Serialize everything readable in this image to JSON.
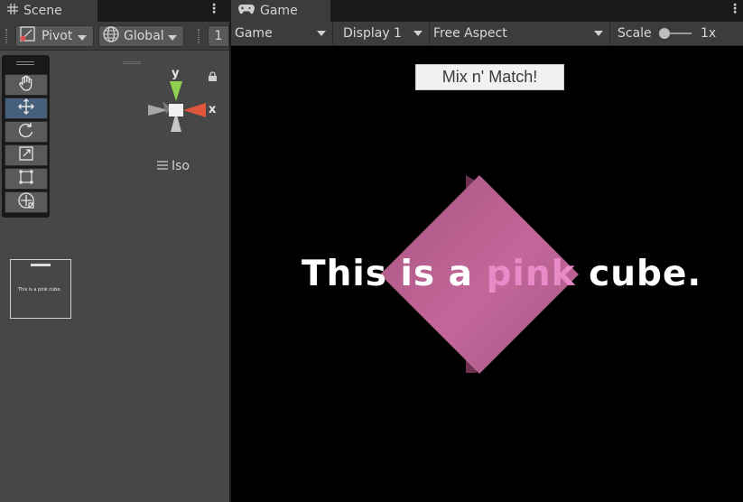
{
  "scene": {
    "tab_label": "Scene",
    "toolbar": {
      "pivot_label": "Pivot",
      "global_label": "Global",
      "snap_value": "1"
    },
    "tools": [
      {
        "name": "hand-tool",
        "icon": "hand-icon"
      },
      {
        "name": "move-tool",
        "icon": "move-arrows-icon",
        "active": true
      },
      {
        "name": "rotate-tool",
        "icon": "rotate-icon"
      },
      {
        "name": "scale-tool",
        "icon": "scale-icon"
      },
      {
        "name": "rect-tool",
        "icon": "rect-transform-icon"
      },
      {
        "name": "transform-tool",
        "icon": "transform-icon"
      }
    ],
    "gizmo": {
      "y_label": "y",
      "x_label": "x",
      "y_color": "#8fd14f",
      "x_color": "#e0563c"
    },
    "projection_label": "Iso",
    "preview_text": "This is a pink cube."
  },
  "game": {
    "tab_label": "Game",
    "toolbar": {
      "view_select": "Game",
      "display_select": "Display 1",
      "aspect_select": "Free Aspect",
      "scale_label": "Scale",
      "scale_value": "1x",
      "scale_level": 0
    },
    "button_label": "Mix n' Match!",
    "caption": {
      "before": "This is a ",
      "highlight": "pink",
      "after": " cube."
    },
    "colors": {
      "cube_face": "#b85d8a",
      "cube_side": "#6e3150",
      "highlight": "#e889c8"
    }
  }
}
